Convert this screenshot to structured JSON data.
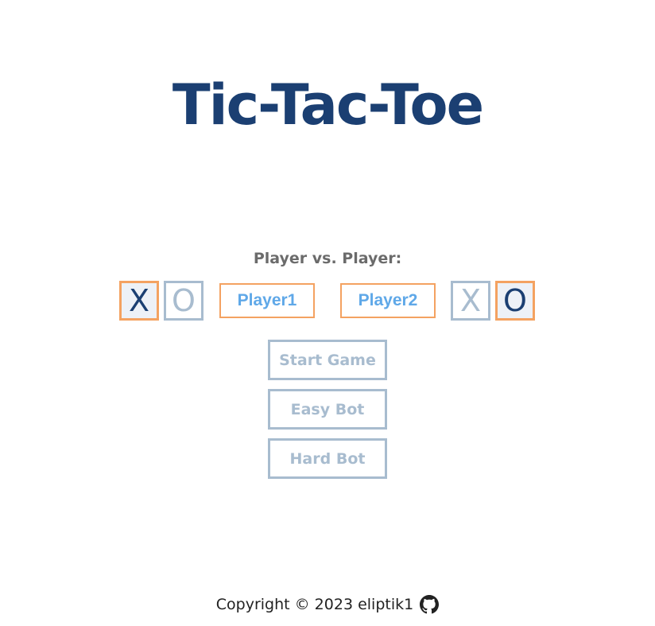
{
  "header": {
    "title": "Tic-Tac-Toe"
  },
  "setup": {
    "mode_label": "Player vs. Player:",
    "player1": {
      "name": "Player1",
      "mark_options": [
        "X",
        "O"
      ],
      "selected_mark": "X"
    },
    "player2": {
      "name": "Player2",
      "mark_options": [
        "X",
        "O"
      ],
      "selected_mark": "O"
    }
  },
  "actions": {
    "start_label": "Start Game",
    "easy_bot_label": "Easy Bot",
    "hard_bot_label": "Hard Bot"
  },
  "footer": {
    "copyright": "Copyright © 2023 eliptik1",
    "github_icon": "github-icon"
  },
  "colors": {
    "title": "#1b3f72",
    "accent_orange": "#f4a261",
    "muted_blue_gray": "#a8bccf",
    "input_text_blue": "#5fa8e8",
    "label_gray": "#6b6b6b"
  }
}
